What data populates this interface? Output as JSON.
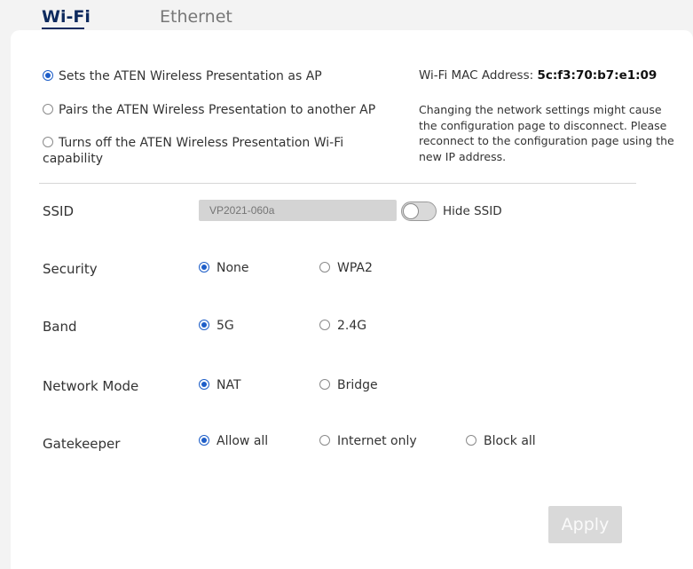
{
  "tabs": {
    "wifi": "Wi-Fi",
    "ethernet": "Ethernet"
  },
  "wifi_mode": {
    "options": [
      "Sets the ATEN Wireless Presentation as AP",
      "Pairs the ATEN Wireless Presentation to another AP",
      "Turns off the ATEN Wireless Presentation Wi-Fi capability"
    ],
    "selected": "Sets the ATEN Wireless Presentation as AP"
  },
  "mac": {
    "label": "Wi-Fi MAC Address:",
    "value": "5c:f3:70:b7:e1:09"
  },
  "note": "Changing the network settings might cause the configuration page to disconnect. Please reconnect to the configuration page using the new IP address.",
  "ssid": {
    "label": "SSID",
    "placeholder": "VP2021-060a",
    "hide_label": "Hide SSID",
    "hide_enabled": false
  },
  "security": {
    "label": "Security",
    "options": [
      "None",
      "WPA2"
    ],
    "selected": "None"
  },
  "band": {
    "label": "Band",
    "options": [
      "5G",
      "2.4G"
    ],
    "selected": "5G"
  },
  "network_mode": {
    "label": "Network Mode",
    "options": [
      "NAT",
      "Bridge"
    ],
    "selected": "NAT"
  },
  "gatekeeper": {
    "label": "Gatekeeper",
    "options": [
      "Allow all",
      "Internet only",
      "Block all"
    ],
    "selected": "Allow all"
  },
  "apply_label": "Apply",
  "colors": {
    "accent": "#1e5ec8",
    "tab_active": "#0d2a5e",
    "button_disabled": "#d9d9d9"
  }
}
